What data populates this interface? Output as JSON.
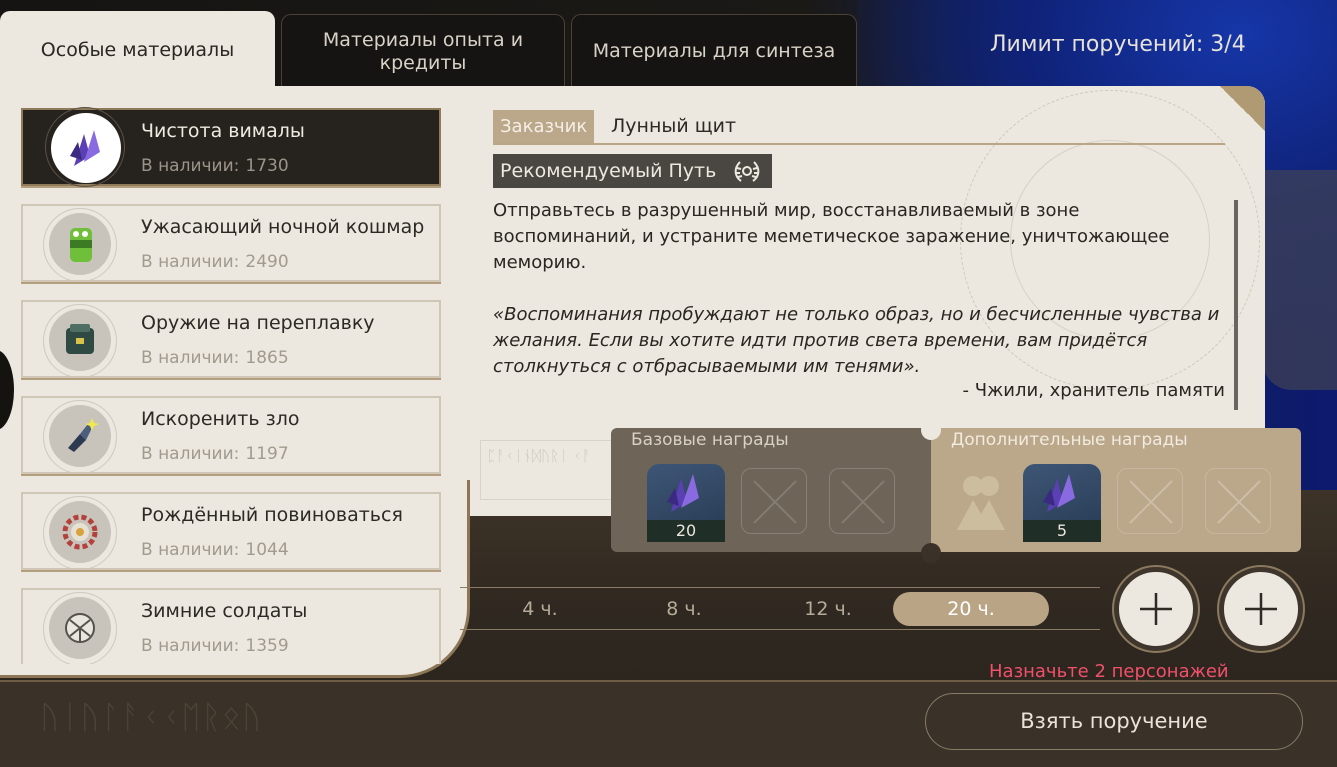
{
  "tabs": [
    {
      "label": "Особые материалы",
      "active": true
    },
    {
      "label": "Материалы опыта и кредиты",
      "active": false
    },
    {
      "label": "Материалы для синтеза",
      "active": false
    }
  ],
  "commission_limit": "Лимит поручений: 3/4",
  "qty_label": "В наличии:",
  "items": [
    {
      "name": "Чистота вималы",
      "qty": "1730",
      "icon": "crystal-icon",
      "selected": true
    },
    {
      "name": "Ужасающий ночной кошмар",
      "qty": "2490",
      "icon": "battery-creature-icon",
      "selected": false
    },
    {
      "name": "Оружие на переплавку",
      "qty": "1865",
      "icon": "armor-chest-icon",
      "selected": false
    },
    {
      "name": "Искоренить зло",
      "qty": "1197",
      "icon": "sparkle-tool-icon",
      "selected": false
    },
    {
      "name": "Рождённый повиноваться",
      "qty": "1044",
      "icon": "gear-badge-icon",
      "selected": false
    },
    {
      "name": "Зимние солдаты",
      "qty": "1359",
      "icon": "fan-shell-icon",
      "selected": false
    }
  ],
  "details": {
    "client_label": "Заказчик",
    "client_value": "Лунный щит",
    "path_label": "Рекомендуемый Путь",
    "path_icon": "laurel-icon",
    "description": "Отправьтесь в разрушенный мир, восстанавливаемый в зоне воспоминаний, и устраните меметическое заражение, уничтожающее меморию.",
    "quote": "«Воспоминания пробуждают не только образ, но и бесчисленные чувства и желания. Если вы хотите идти против света времени, вам придётся столкнуться с отбрасываемыми им тенями».",
    "quote_author": "- Чжили, хранитель памяти"
  },
  "rewards": {
    "base_title": "Базовые награды",
    "extra_title": "Дополнительные награды",
    "base_count": "20",
    "extra_count": "5"
  },
  "durations": [
    {
      "label": "4 ч.",
      "active": false
    },
    {
      "label": "8 ч.",
      "active": false
    },
    {
      "label": "12 ч.",
      "active": false
    },
    {
      "label": "20 ч.",
      "active": true
    }
  ],
  "assign_message": "Назначьте 2 персонажей",
  "take_button": "Взять поручение",
  "colors": {
    "accent": "#b9a585",
    "warning": "#f0506a",
    "panel": "#ece8e0",
    "dark": "#26221e"
  }
}
